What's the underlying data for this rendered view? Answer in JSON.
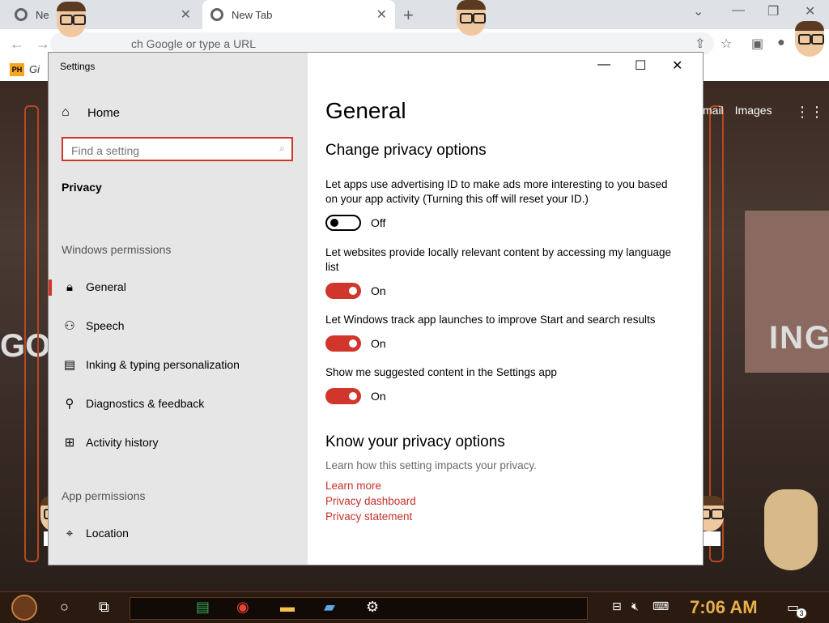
{
  "browser": {
    "tabs": [
      {
        "title": "Ne",
        "active": false
      },
      {
        "title": "New Tab",
        "active": true
      }
    ],
    "new_tab_symbol": "+",
    "window_controls": {
      "minimize": "—",
      "restore": "❐",
      "close": "✕"
    },
    "omnibox_placeholder": "ch Google or type a URL",
    "bookmark": {
      "favicon_text": "PH",
      "label": "Gi"
    }
  },
  "google_page": {
    "links": [
      "mail",
      "Images"
    ],
    "apps_icon": "apps-grid-icon",
    "background_text": [
      "GO",
      "ING"
    ]
  },
  "settings": {
    "window_title": "Settings",
    "controls": {
      "minimize": "—",
      "maximize": "☐",
      "close": "✕"
    },
    "sidebar": {
      "home_label": "Home",
      "search_placeholder": "Find a setting",
      "breadcrumb": "Privacy",
      "windows_permissions_heading": "Windows permissions",
      "items": [
        {
          "label": "General",
          "icon": "lock-icon",
          "selected": true
        },
        {
          "label": "Speech",
          "icon": "speech-icon",
          "selected": false
        },
        {
          "label": "Inking & typing personalization",
          "icon": "inking-icon",
          "selected": false
        },
        {
          "label": "Diagnostics & feedback",
          "icon": "diagnostics-icon",
          "selected": false
        },
        {
          "label": "Activity history",
          "icon": "activity-icon",
          "selected": false
        }
      ],
      "app_permissions_heading": "App permissions",
      "app_items": [
        {
          "label": "Location",
          "icon": "location-icon"
        }
      ]
    },
    "main": {
      "title": "General",
      "section1_heading": "Change privacy options",
      "options": [
        {
          "text": "Let apps use advertising ID to make ads more interesting to you based on your app activity (Turning this off will reset your ID.)",
          "state": "Off"
        },
        {
          "text": "Let websites provide locally relevant content by accessing my language list",
          "state": "On"
        },
        {
          "text": "Let Windows track app launches to improve Start and search results",
          "state": "On"
        },
        {
          "text": "Show me suggested content in the Settings app",
          "state": "On"
        }
      ],
      "section2_heading": "Know your privacy options",
      "section2_desc": "Learn how this setting impacts your privacy.",
      "links": [
        "Learn more",
        "Privacy dashboard",
        "Privacy statement"
      ]
    }
  },
  "taskbar": {
    "clock": "7:06 AM",
    "notification_count": "3",
    "apps": [
      "cortana-icon",
      "task-view-icon",
      "sheets-icon",
      "chrome-icon",
      "file-explorer-icon",
      "remote-desktop-icon",
      "settings-gear-icon"
    ]
  },
  "colors": {
    "accent": "#d0362b",
    "link": "#c4322a",
    "sidebar_bg": "#e6e6e6",
    "clock": "#e8b04a"
  }
}
